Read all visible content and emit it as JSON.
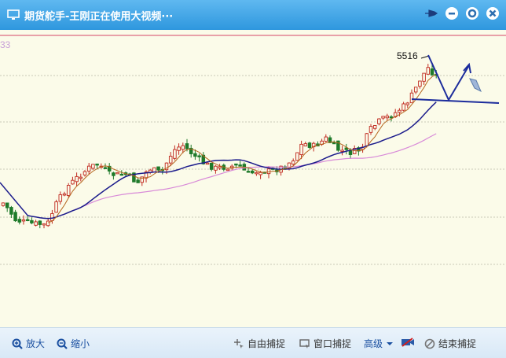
{
  "window": {
    "title": "期货舵手-王刚正在使用大视频···",
    "corner_number": "33",
    "peak_label": "5516"
  },
  "toolbar": {
    "zoom_in": "放大",
    "zoom_out": "缩小",
    "free_capture": "自由捕捉",
    "window_capture": "窗口捕捉",
    "advanced": "高级",
    "end_capture": "结束捕捉"
  },
  "colors": {
    "title_bar": "#2e97de",
    "chart_bg": "#fbfbe9",
    "up_candle": "#c0281e",
    "down_candle": "#1e7a2a",
    "ma_short": "#b5651d",
    "ma_mid": "#1c1c8c",
    "ma_long": "#d88ad8",
    "annotation": "#1c2c9c"
  }
}
